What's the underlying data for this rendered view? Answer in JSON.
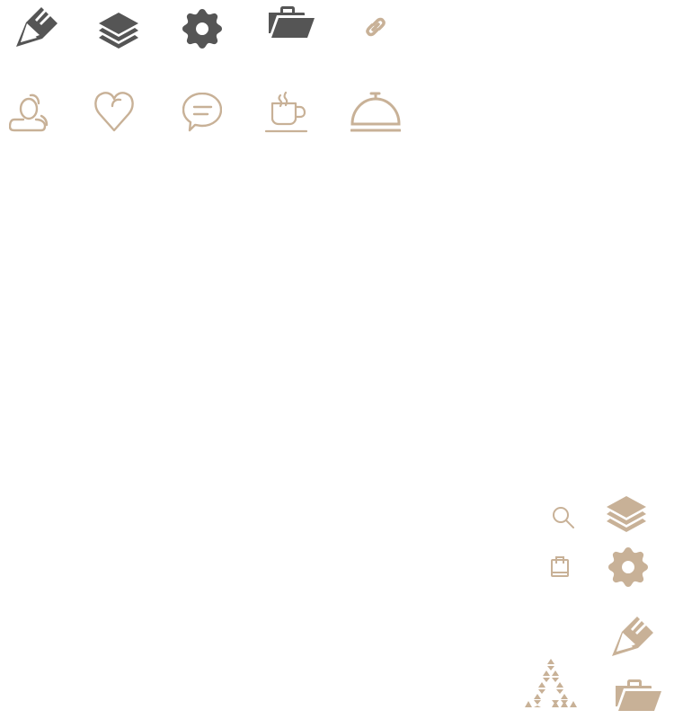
{
  "colors": {
    "dark": "#555555",
    "tan": "#c8b197"
  },
  "icons": [
    {
      "name": "pencil-fork-icon",
      "symbol": "pencil",
      "tone": "dark"
    },
    {
      "name": "layers-icon",
      "symbol": "layers",
      "tone": "dark"
    },
    {
      "name": "gear-icon",
      "symbol": "gear",
      "tone": "dark"
    },
    {
      "name": "folder-open-icon",
      "symbol": "folder",
      "tone": "dark"
    },
    {
      "name": "link-icon",
      "symbol": "link",
      "tone": "tan"
    },
    {
      "name": "user-icon",
      "symbol": "user",
      "tone": "tan"
    },
    {
      "name": "heart-icon",
      "symbol": "heart",
      "tone": "tan"
    },
    {
      "name": "chat-bubble-icon",
      "symbol": "chat",
      "tone": "tan"
    },
    {
      "name": "coffee-cup-icon",
      "symbol": "coffee",
      "tone": "tan"
    },
    {
      "name": "service-bell-icon",
      "symbol": "bell",
      "tone": "tan"
    },
    {
      "name": "search-icon",
      "symbol": "search",
      "tone": "tan"
    },
    {
      "name": "layers-icon",
      "symbol": "layers",
      "tone": "tan"
    },
    {
      "name": "shopping-bag-icon",
      "symbol": "bag",
      "tone": "tan"
    },
    {
      "name": "gear-icon",
      "symbol": "gear",
      "tone": "tan"
    },
    {
      "name": "pencil-fork-icon",
      "symbol": "pencil",
      "tone": "tan"
    },
    {
      "name": "triangle-logo-icon",
      "symbol": "triangle",
      "tone": "tan"
    },
    {
      "name": "folder-open-icon",
      "symbol": "folder",
      "tone": "tan"
    }
  ]
}
